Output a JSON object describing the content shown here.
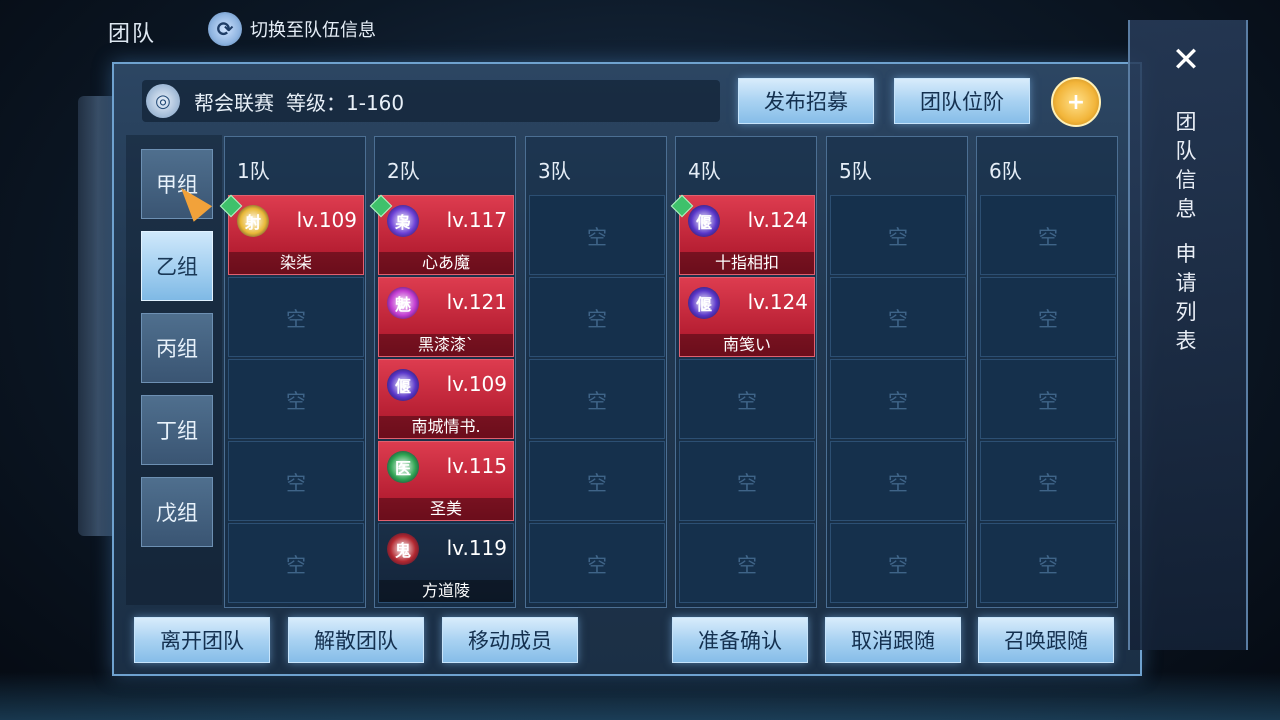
{
  "header": {
    "title": "团队",
    "switch_label": "切换至队伍信息",
    "switch_icon": "refresh-icon"
  },
  "info": {
    "activity": "帮会联赛",
    "level": "等级：1-160"
  },
  "actions": {
    "recruit": "发布招募",
    "rank": "团队位阶"
  },
  "groups": [
    "甲组",
    "乙组",
    "丙组",
    "丁组",
    "戊组"
  ],
  "teams": [
    {
      "label": "1队",
      "members": [
        {
          "icon": "射",
          "icon_color": "#e8b837",
          "level": "lv.109",
          "name": "染柒",
          "leader": true
        }
      ]
    },
    {
      "label": "2队",
      "members": [
        {
          "icon": "枭",
          "icon_color": "#6b3fd6",
          "level": "lv.117",
          "name": "心あ魔",
          "leader": true
        },
        {
          "icon": "魅",
          "icon_color": "#c13bd0",
          "level": "lv.121",
          "name": "黑漆漆`"
        },
        {
          "icon": "偃",
          "icon_color": "#5936c9",
          "level": "lv.109",
          "name": "南城情书."
        },
        {
          "icon": "医",
          "icon_color": "#2fa452",
          "level": "lv.115",
          "name": "圣美"
        },
        {
          "icon": "鬼",
          "icon_color": "#b32830",
          "level": "lv.119",
          "name": "方道陵",
          "dark": true
        }
      ]
    },
    {
      "label": "3队",
      "members": []
    },
    {
      "label": "4队",
      "members": [
        {
          "icon": "偃",
          "icon_color": "#5936c9",
          "level": "lv.124",
          "name": "十指相扣",
          "leader": true
        },
        {
          "icon": "偃",
          "icon_color": "#5936c9",
          "level": "lv.124",
          "name": "南笺い"
        }
      ]
    },
    {
      "label": "5队",
      "members": []
    },
    {
      "label": "6队",
      "members": []
    }
  ],
  "empty_label": "空",
  "bottom": {
    "leave": "离开团队",
    "disband": "解散团队",
    "move": "移动成员",
    "ready": "准备确认",
    "cancel_follow": "取消跟随",
    "summon_follow": "召唤跟随"
  },
  "side": {
    "team_info": "团队信息",
    "apply_list": "申请列表"
  }
}
